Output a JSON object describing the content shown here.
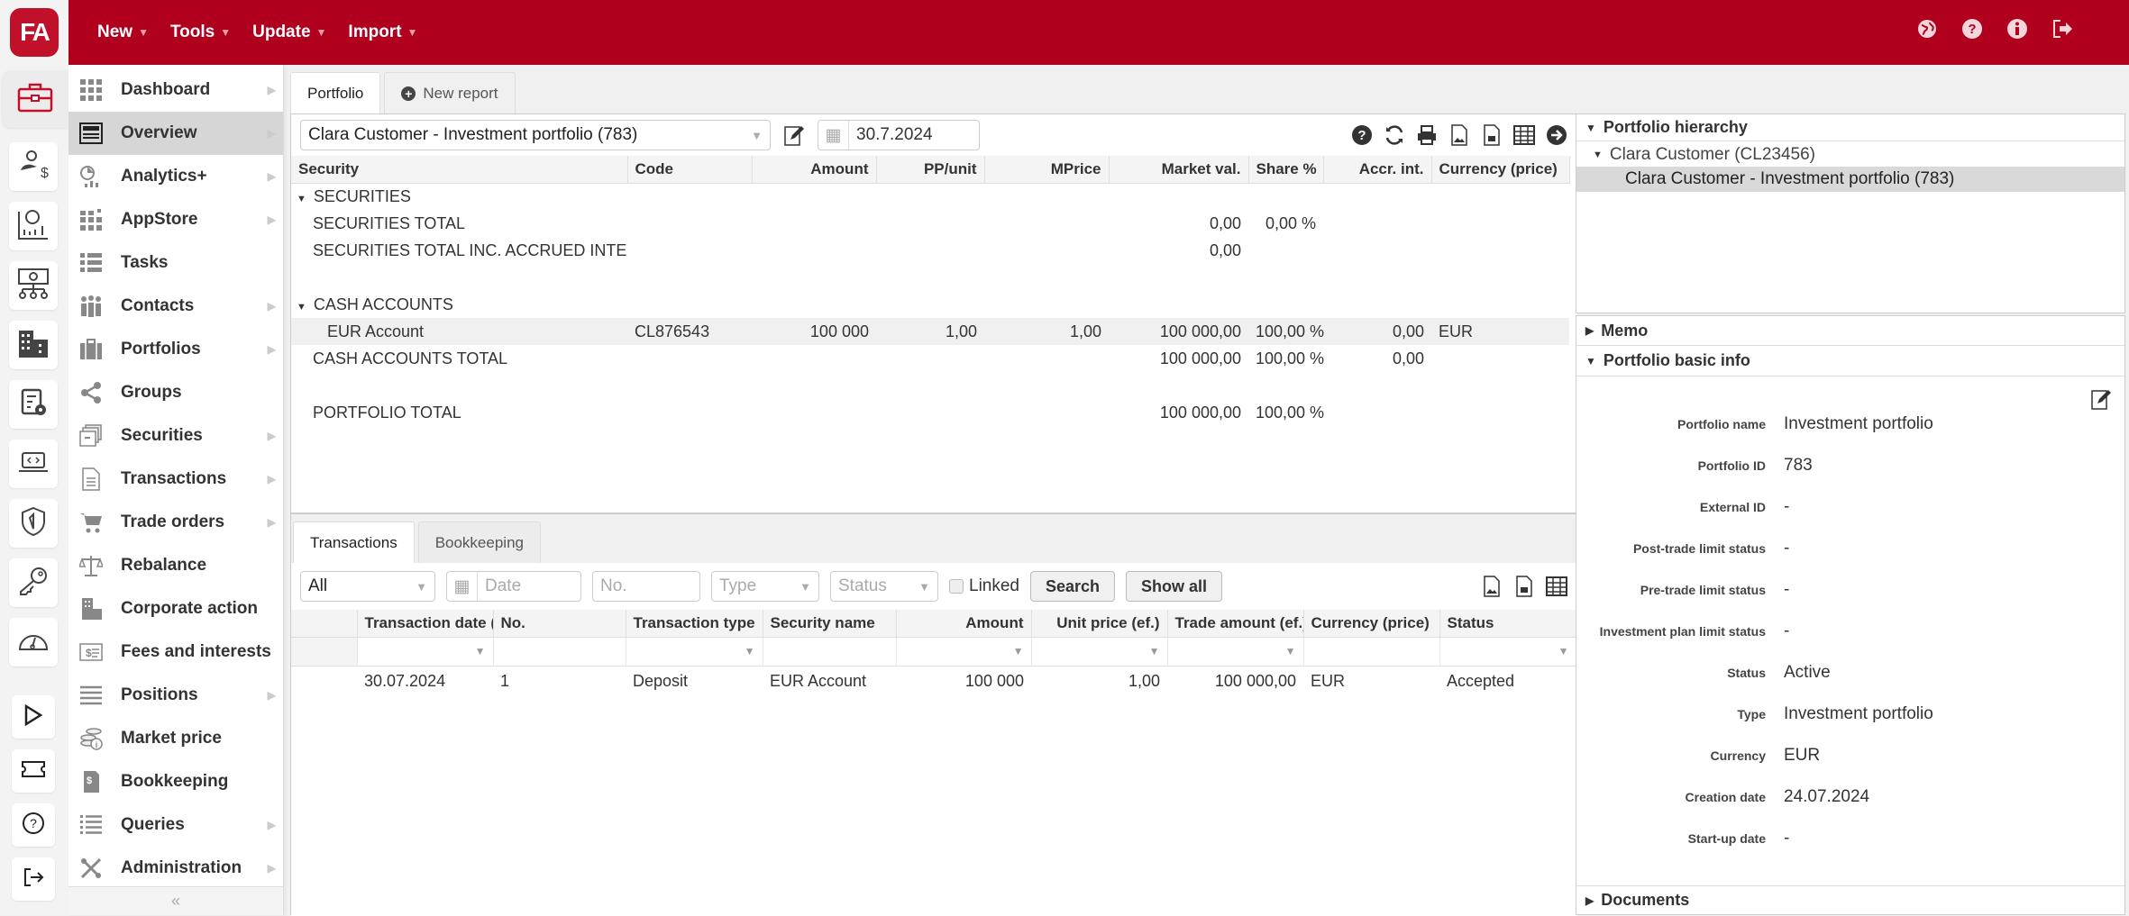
{
  "app": {
    "logo_text": "FA"
  },
  "topbar": {
    "menus": [
      "New",
      "Tools",
      "Update",
      "Import"
    ],
    "icons": [
      "globe-icon",
      "help-icon",
      "info-icon",
      "logout-icon"
    ]
  },
  "nav": {
    "items": [
      {
        "label": "Dashboard",
        "icon": "grid-icon",
        "arrow": true
      },
      {
        "label": "Overview",
        "icon": "overview-icon",
        "arrow": true,
        "active": true
      },
      {
        "label": "Analytics+",
        "icon": "analytics-icon",
        "arrow": true
      },
      {
        "label": "AppStore",
        "icon": "appstore-icon",
        "arrow": true
      },
      {
        "label": "Tasks",
        "icon": "tasks-icon",
        "arrow": false
      },
      {
        "label": "Contacts",
        "icon": "contacts-icon",
        "arrow": true
      },
      {
        "label": "Portfolios",
        "icon": "briefcase-icon",
        "arrow": true
      },
      {
        "label": "Groups",
        "icon": "share-icon",
        "arrow": false
      },
      {
        "label": "Securities",
        "icon": "securities-icon",
        "arrow": true
      },
      {
        "label": "Transactions",
        "icon": "document-icon",
        "arrow": true
      },
      {
        "label": "Trade orders",
        "icon": "cart-icon",
        "arrow": true
      },
      {
        "label": "Rebalance",
        "icon": "scale-icon",
        "arrow": false
      },
      {
        "label": "Corporate action",
        "icon": "building-icon",
        "arrow": false
      },
      {
        "label": "Fees and interests",
        "icon": "fees-icon",
        "arrow": false
      },
      {
        "label": "Positions",
        "icon": "list-icon",
        "arrow": true
      },
      {
        "label": "Market price",
        "icon": "coins-icon",
        "arrow": false
      },
      {
        "label": "Bookkeeping",
        "icon": "bookkeeping-icon",
        "arrow": false
      },
      {
        "label": "Queries",
        "icon": "queries-icon",
        "arrow": true
      },
      {
        "label": "Administration",
        "icon": "tools-icon",
        "arrow": true
      }
    ],
    "collapse_label": "«"
  },
  "main": {
    "tabs": [
      {
        "label": "Portfolio"
      },
      {
        "label": "New report"
      }
    ],
    "portfolio_select": "Clara Customer - Investment portfolio (783)",
    "date": "30.7.2024",
    "columns": [
      "Security",
      "Code",
      "Amount",
      "PP/unit",
      "MPrice",
      "Market val.",
      "Share %",
      "Accr. int.",
      "Currency (price)"
    ],
    "rows": [
      {
        "type": "group",
        "cells": [
          "SECURITIES",
          "",
          "",
          "",
          "",
          "",
          "",
          "",
          ""
        ]
      },
      {
        "type": "total",
        "cells": [
          "SECURITIES TOTAL",
          "",
          "",
          "",
          "",
          "0,00",
          "0,00 %",
          "",
          ""
        ]
      },
      {
        "type": "total",
        "cells": [
          "SECURITIES TOTAL INC. ACCRUED INTERE",
          "",
          "",
          "",
          "",
          "0,00",
          "",
          "",
          ""
        ]
      },
      {
        "type": "blank",
        "cells": [
          "",
          "",
          "",
          "",
          "",
          "",
          "",
          "",
          ""
        ]
      },
      {
        "type": "group",
        "cells": [
          "CASH ACCOUNTS",
          "",
          "",
          "",
          "",
          "",
          "",
          "",
          ""
        ]
      },
      {
        "type": "item",
        "cells": [
          "EUR Account",
          "CL876543",
          "100 000",
          "1,00",
          "1,00",
          "100 000,00",
          "100,00 %",
          "0,00",
          "EUR"
        ]
      },
      {
        "type": "total",
        "cells": [
          "CASH ACCOUNTS TOTAL",
          "",
          "",
          "",
          "",
          "100 000,00",
          "100,00 %",
          "0,00",
          ""
        ]
      },
      {
        "type": "blank",
        "cells": [
          "",
          "",
          "",
          "",
          "",
          "",
          "",
          "",
          ""
        ]
      },
      {
        "type": "total",
        "cells": [
          "PORTFOLIO TOTAL",
          "",
          "",
          "",
          "",
          "100 000,00",
          "100,00 %",
          "",
          ""
        ]
      }
    ]
  },
  "transactions": {
    "tabs": [
      {
        "label": "Transactions"
      },
      {
        "label": "Bookkeeping"
      }
    ],
    "filter": {
      "scope": "All",
      "date_placeholder": "Date",
      "no_placeholder": "No.",
      "type_placeholder": "Type",
      "status_placeholder": "Status",
      "linked_label": "Linked",
      "search_label": "Search",
      "show_all_label": "Show all"
    },
    "columns": [
      "",
      "Transaction date (e",
      "No.",
      "Transaction type",
      "Security name",
      "Amount",
      "Unit price (ef.)",
      "Trade amount (ef.)",
      "Currency (price)",
      "Status"
    ],
    "rows": [
      [
        "",
        "30.07.2024",
        "1",
        "Deposit",
        "EUR Account",
        "100 000",
        "1,00",
        "100 000,00",
        "EUR",
        "Accepted"
      ]
    ]
  },
  "right": {
    "hierarchy_title": "Portfolio hierarchy",
    "hierarchy": [
      {
        "label": "Clara Customer (CL23456)",
        "level": 0
      },
      {
        "label": "Clara Customer - Investment portfolio (783)",
        "level": 1,
        "selected": true
      }
    ],
    "memo_title": "Memo",
    "basic_info_title": "Portfolio basic info",
    "basic_info": [
      {
        "label": "Portfolio name",
        "value": "Investment portfolio"
      },
      {
        "label": "Portfolio ID",
        "value": "783"
      },
      {
        "label": "External ID",
        "value": "-"
      },
      {
        "label": "Post-trade limit status",
        "value": "-"
      },
      {
        "label": "Pre-trade limit status",
        "value": "-"
      },
      {
        "label": "Investment plan limit status",
        "value": "-"
      },
      {
        "label": "Status",
        "value": "Active"
      },
      {
        "label": "Type",
        "value": "Investment portfolio"
      },
      {
        "label": "Currency",
        "value": "EUR"
      },
      {
        "label": "Creation date",
        "value": "24.07.2024"
      },
      {
        "label": "Start-up date",
        "value": "-"
      }
    ],
    "documents_title": "Documents"
  }
}
